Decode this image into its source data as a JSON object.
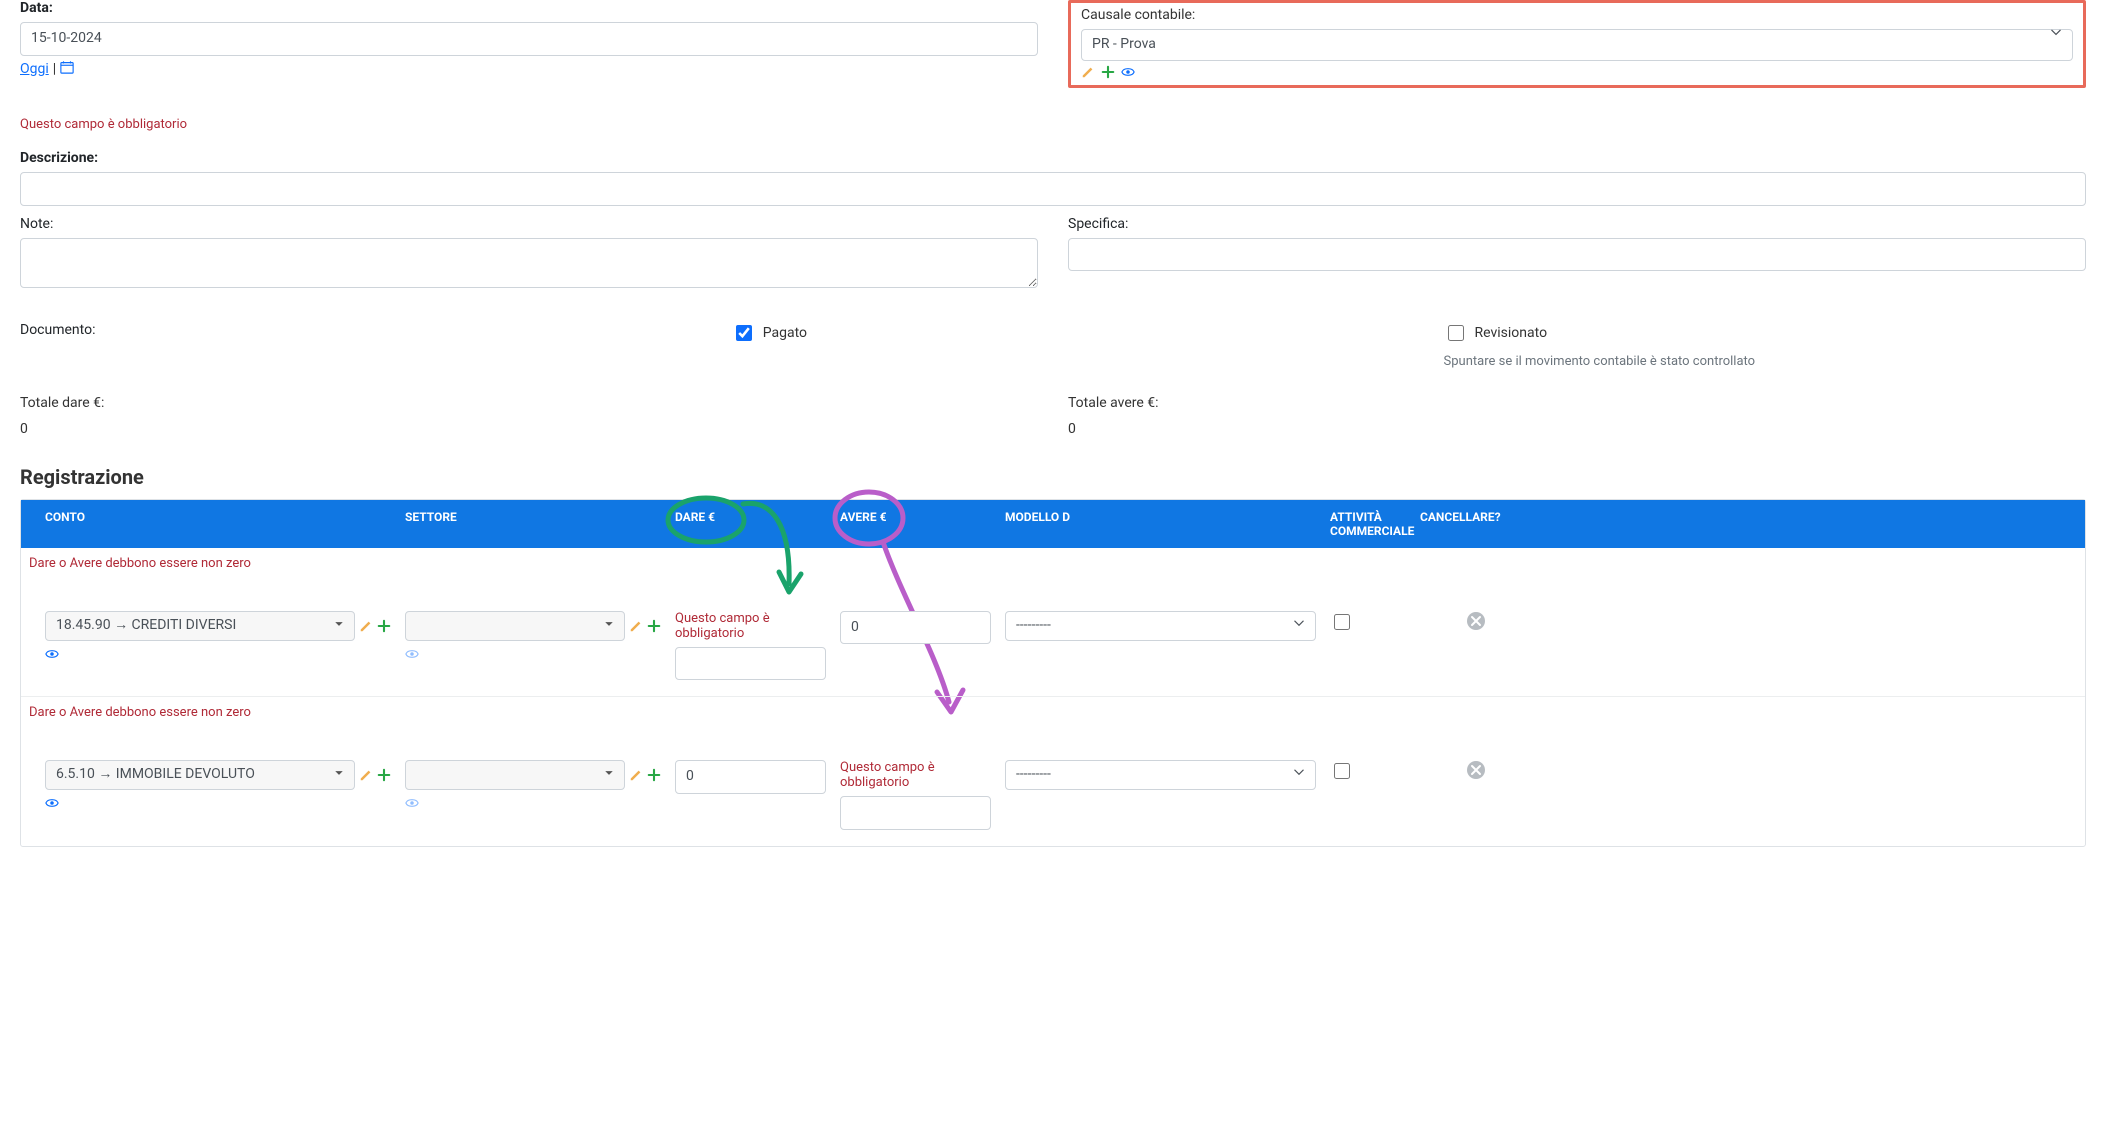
{
  "fields": {
    "data_label": "Data:",
    "data_value": "15-10-2024",
    "oggi_link": "Oggi",
    "causale_label": "Causale contabile:",
    "causale_value": "PR - Prova",
    "required_msg": "Questo campo è obbligatorio",
    "descrizione_label": "Descrizione:",
    "descrizione_value": "",
    "note_label": "Note:",
    "note_value": "",
    "specifica_label": "Specifica:",
    "specifica_value": "",
    "documento_label": "Documento:",
    "pagato_label": "Pagato",
    "revisionato_label": "Revisionato",
    "revisionato_help": "Spuntare se il movimento contabile è stato controllato",
    "tot_dare_label": "Totale dare €:",
    "tot_dare_value": "0",
    "tot_avere_label": "Totale avere €:",
    "tot_avere_value": "0"
  },
  "section_title": "Registrazione",
  "table": {
    "headers": {
      "conto": "CONTO",
      "settore": "SETTORE",
      "dare": "DARE €",
      "avere": "AVERE €",
      "modellod": "MODELLO D",
      "attivita": "ATTIVITÀ COMMERCIALE",
      "cancella": "CANCELLARE?"
    },
    "row_error": "Dare o Avere debbono essere non zero",
    "required_msg": "Questo campo è obbligatorio",
    "modellod_placeholder": "---------",
    "rows": [
      {
        "conto": "18.45.90 → CREDITI DIVERSI",
        "settore": "",
        "dare": "",
        "avere": "0",
        "dare_err": true,
        "avere_err": false
      },
      {
        "conto": "6.5.10 → IMMOBILE DEVOLUTO",
        "settore": "",
        "dare": "0",
        "avere": "",
        "dare_err": false,
        "avere_err": true
      }
    ]
  }
}
